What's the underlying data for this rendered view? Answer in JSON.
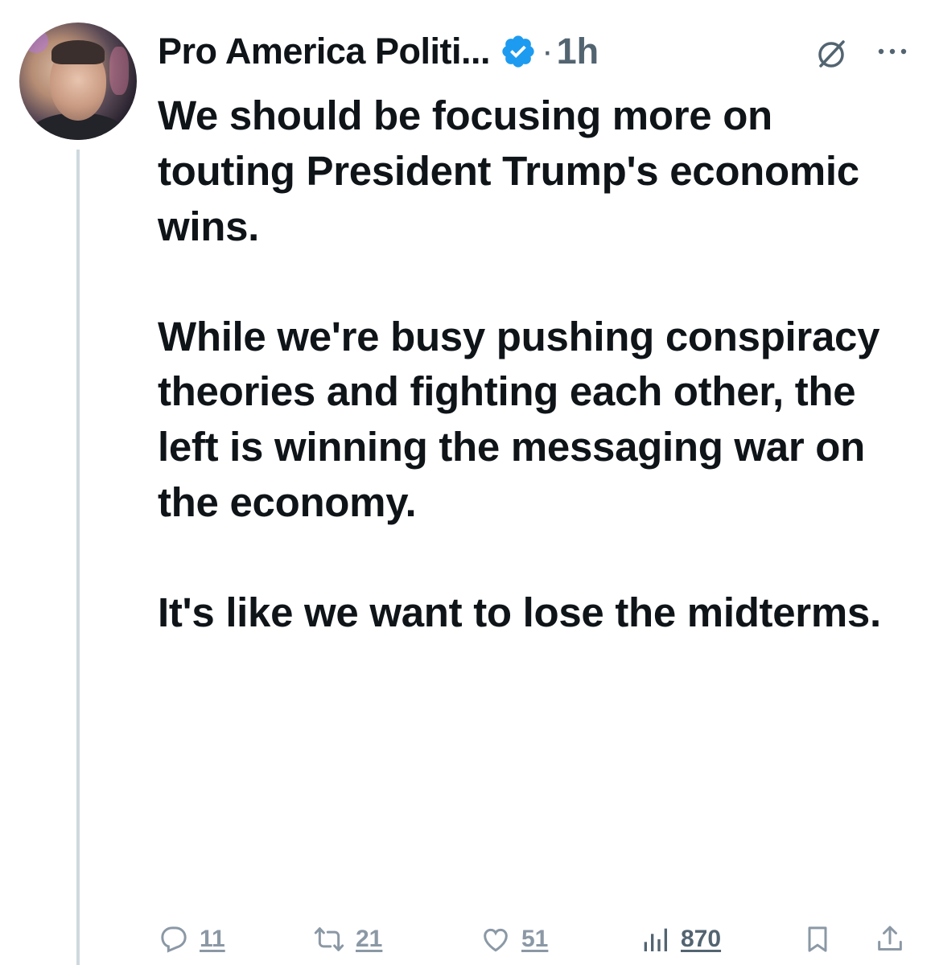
{
  "post": {
    "author_name": "Pro America Politi...",
    "separator": "·",
    "timestamp": "1h",
    "paragraphs": [
      "We should be focusing more on touting President Trump's economic wins.",
      "While we're busy pushing conspiracy theories and fighting each other, the left is winning the messaging war on the economy.",
      "It's like we want to lose the midterms."
    ]
  },
  "actions": {
    "replies": "11",
    "reposts": "21",
    "likes": "51",
    "views": "870"
  },
  "icons": {
    "verified": "verified-badge-icon",
    "grok": "grok-icon",
    "more": "more-options-icon",
    "reply": "reply-icon",
    "repost": "repost-icon",
    "like": "like-icon",
    "views": "views-icon",
    "bookmark": "bookmark-icon",
    "share": "share-icon"
  },
  "colors": {
    "text": "#0f1419",
    "secondary": "#536471",
    "verified": "#1d9bf0",
    "thread_line": "#cfd9de"
  }
}
